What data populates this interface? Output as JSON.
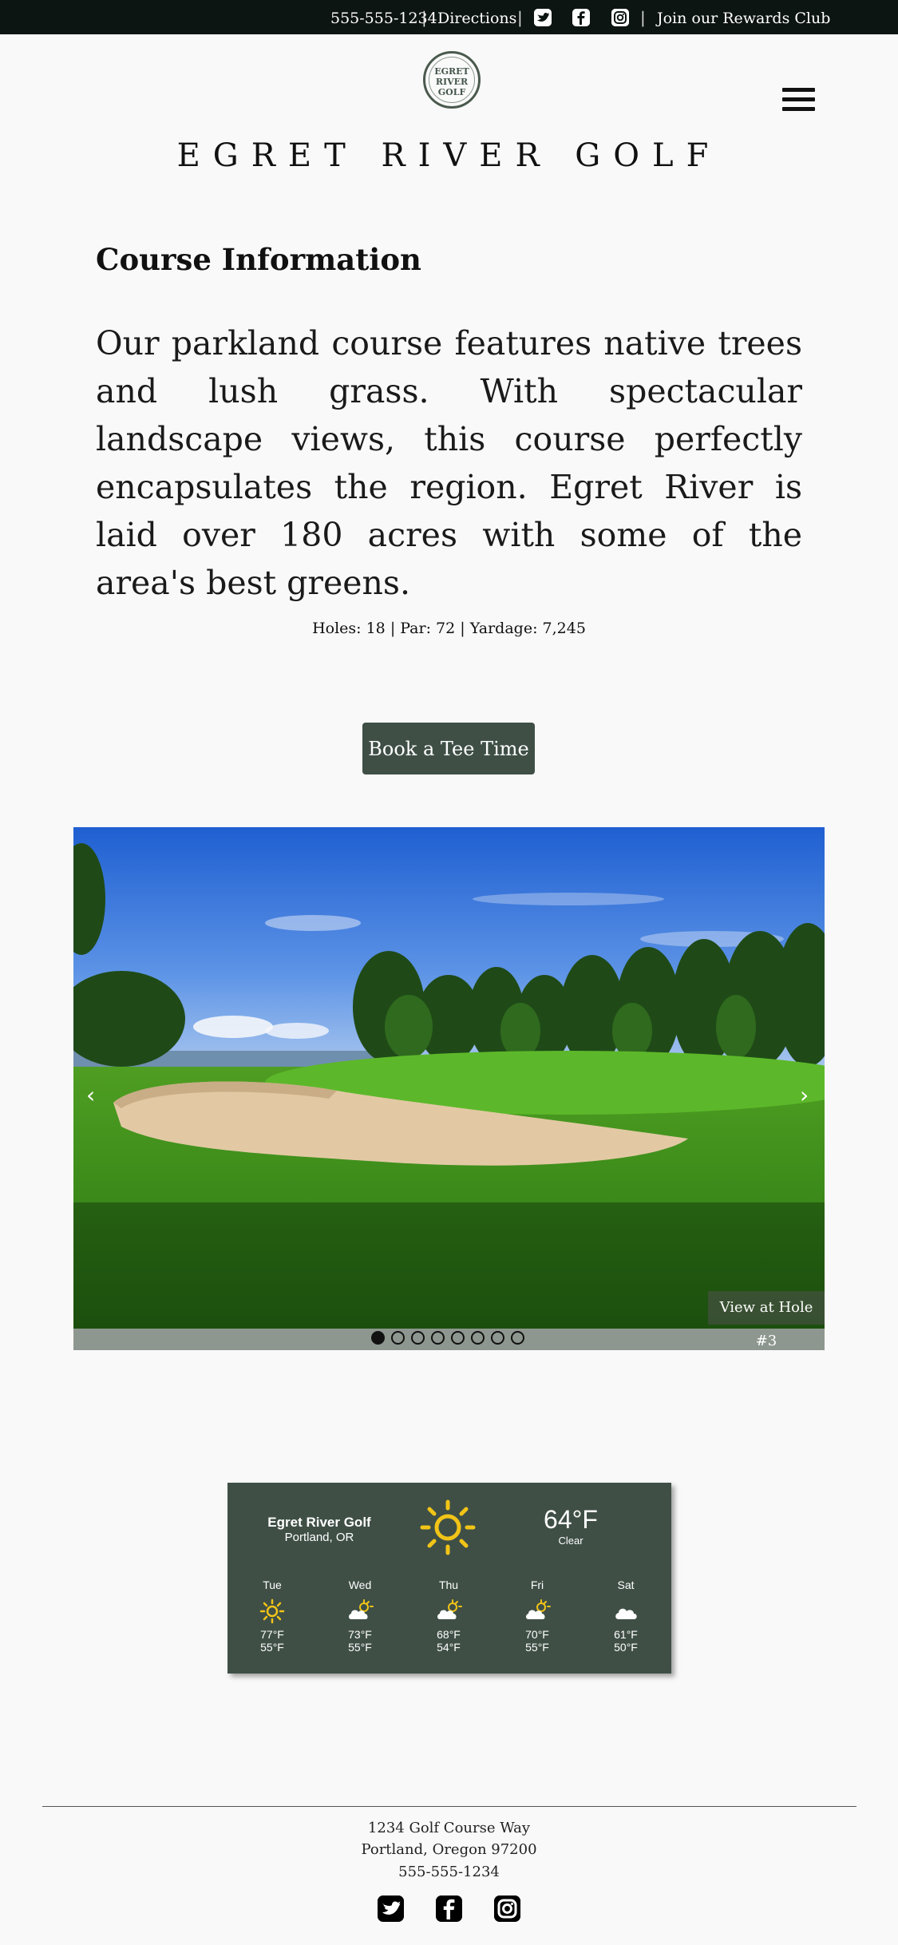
{
  "topbar": {
    "phone": "555-555-1234",
    "directions": "Directions",
    "rewards": "Join our Rewards Club",
    "icons": [
      "twitter-icon",
      "facebook-icon",
      "instagram-icon"
    ]
  },
  "header": {
    "logo_text": "EGRET\nRIVER\nGOLF",
    "site_title": "EGRET RIVER GOLF"
  },
  "course": {
    "title": "Course Information",
    "description": "Our parkland course features native trees and lush grass. With spectacular landscape views, this course perfectly encapsulates the region. Egret River is laid over 180 acres with some of the area's best greens.",
    "stats": "Holes: 18 | Par: 72 | Yardage: 7,245",
    "book_label": "Book a Tee Time"
  },
  "carousel": {
    "caption": "View at Hole #3",
    "prev": "‹",
    "next": "›",
    "slide_count": 8,
    "active_index": 0
  },
  "weather": {
    "location": "Egret River Golf",
    "city": "Portland, OR",
    "current_temp": "64°F",
    "condition": "Clear",
    "forecast": [
      {
        "day": "Tue",
        "icon": "sun-icon",
        "hi": "77°F",
        "lo": "55°F"
      },
      {
        "day": "Wed",
        "icon": "partly-cloudy-icon",
        "hi": "73°F",
        "lo": "55°F"
      },
      {
        "day": "Thu",
        "icon": "partly-cloudy-icon",
        "hi": "68°F",
        "lo": "54°F"
      },
      {
        "day": "Fri",
        "icon": "partly-cloudy-icon",
        "hi": "70°F",
        "lo": "55°F"
      },
      {
        "day": "Sat",
        "icon": "cloud-icon",
        "hi": "61°F",
        "lo": "50°F"
      }
    ],
    "colors": {
      "panel": "#3f4f46",
      "sun": "#f2c417"
    }
  },
  "footer": {
    "address1": "1234 Golf Course Way",
    "address2": "Portland, Oregon 97200",
    "phone": "555-555-1234",
    "icons": [
      "twitter-icon",
      "facebook-icon",
      "instagram-icon"
    ]
  }
}
